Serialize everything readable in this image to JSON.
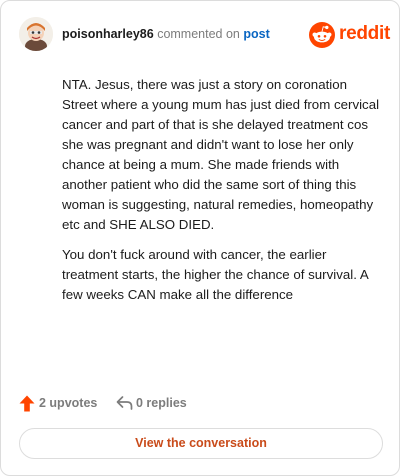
{
  "comment": {
    "username": "poisonharley86",
    "action_text": "commented on",
    "post_link": "post",
    "paragraphs": [
      "NTA. Jesus, there was just a story on coronation Street where a young mum has just died from cervical cancer and part of that is she delayed treatment cos she was pregnant and didn't want to lose her only chance at being a mum. She made friends with another patient who did the same sort of thing this woman is suggesting, natural remedies, homeopathy etc and SHE ALSO DIED.",
      "You don't fuck around with cancer, the earlier treatment starts, the higher the chance of survival. A few weeks CAN make all the difference"
    ]
  },
  "brand": {
    "name": "reddit",
    "icon": "reddit-snoo-icon",
    "color": "#ff4500"
  },
  "actions": {
    "upvotes": "2 upvotes",
    "upvote_icon": "upvote-arrow-icon",
    "upvote_color": "#ff4500",
    "replies": "0 replies",
    "reply_icon": "reply-arrow-icon"
  },
  "cta": {
    "label": "View the conversation"
  }
}
